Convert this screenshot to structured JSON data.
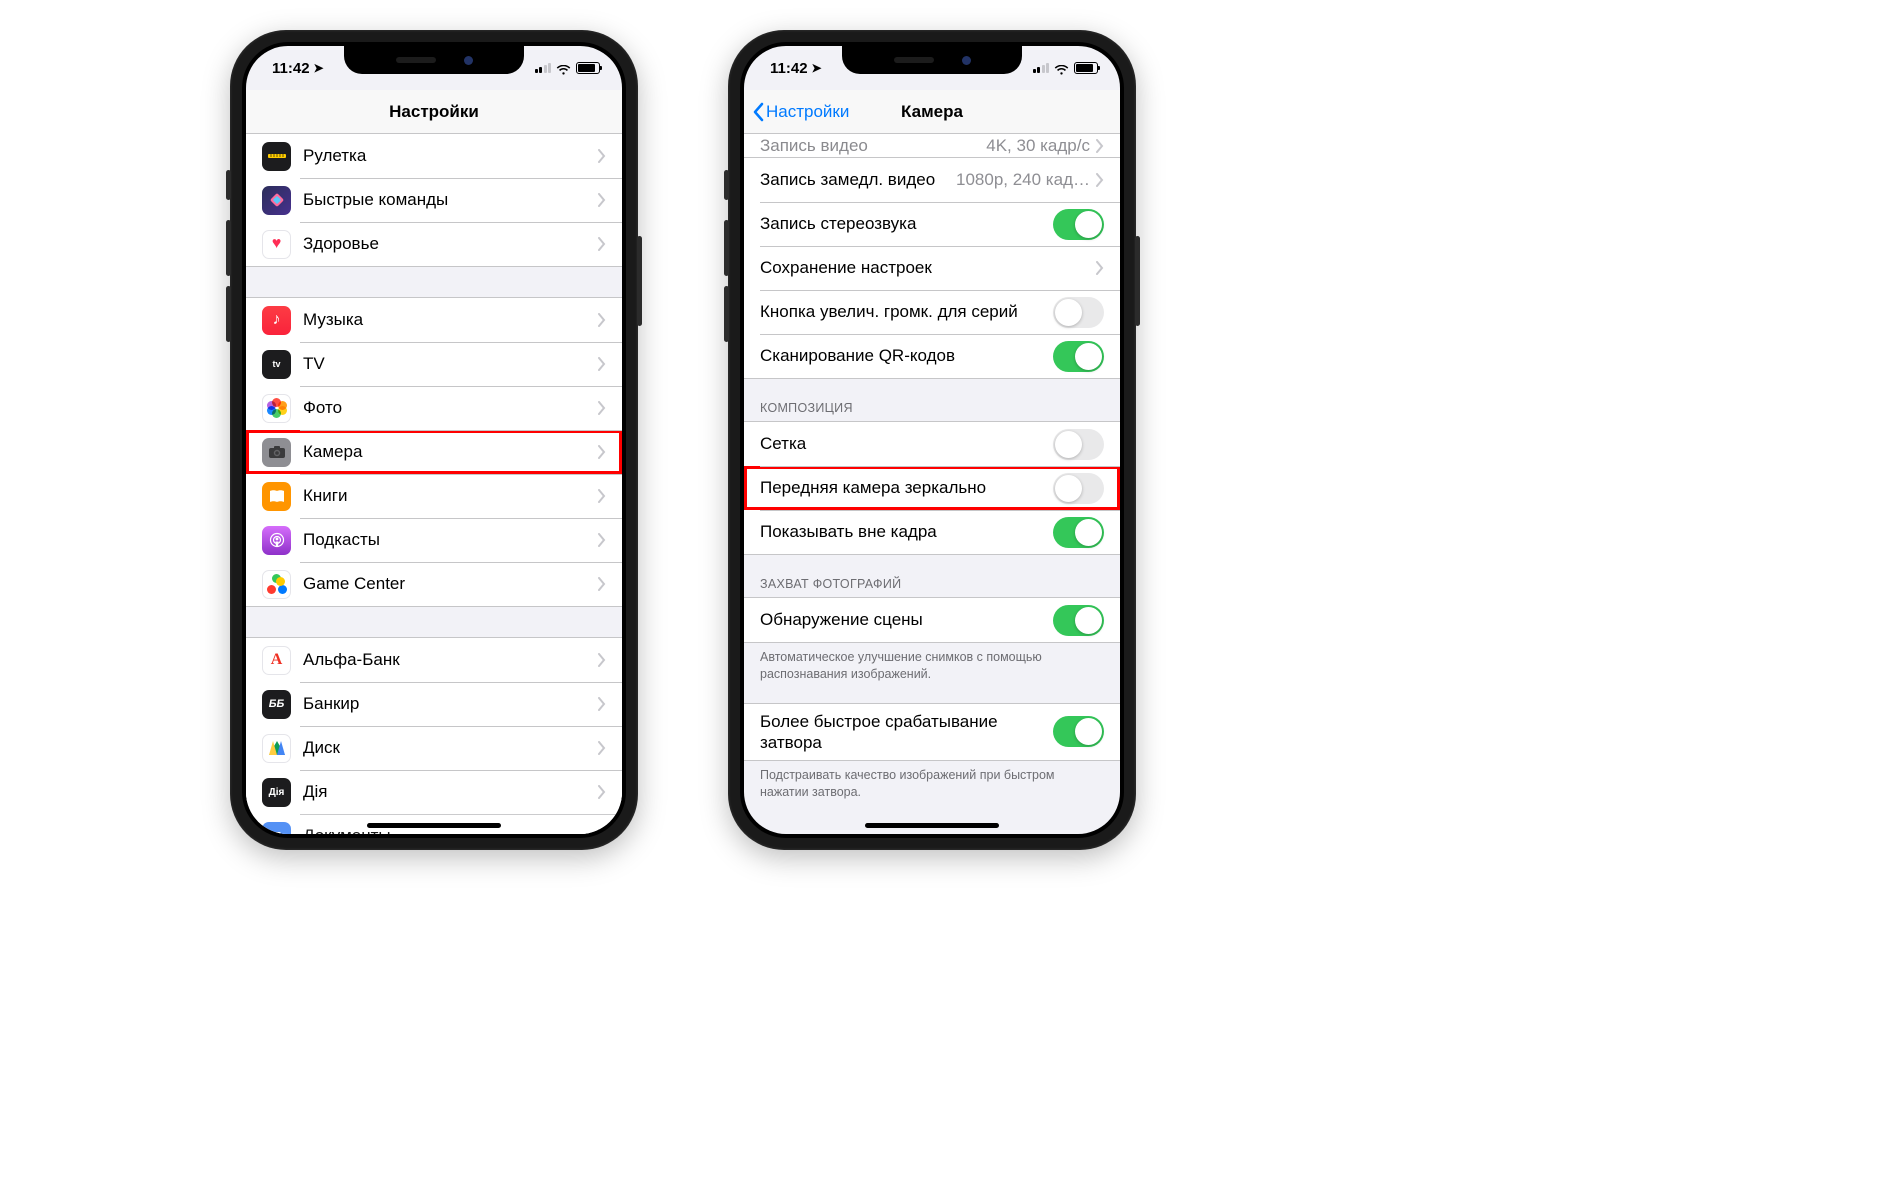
{
  "status": {
    "time": "11:42"
  },
  "left": {
    "nav_title": "Настройки",
    "group1": [
      {
        "label": "Рулетка"
      },
      {
        "label": "Быстрые команды"
      },
      {
        "label": "Здоровье"
      }
    ],
    "group2": [
      {
        "label": "Музыка"
      },
      {
        "label": "TV"
      },
      {
        "label": "Фото"
      },
      {
        "label": "Камера"
      },
      {
        "label": "Книги"
      },
      {
        "label": "Подкасты"
      },
      {
        "label": "Game Center"
      }
    ],
    "group3": [
      {
        "label": "Альфа-Банк"
      },
      {
        "label": "Банкир"
      },
      {
        "label": "Диск"
      },
      {
        "label": "Дія"
      },
      {
        "label": "Документы"
      }
    ]
  },
  "right": {
    "back_label": "Настройки",
    "nav_title": "Камера",
    "partial": {
      "label": "Запись видео",
      "detail": "4K, 30 кадр/с"
    },
    "group1": [
      {
        "label": "Запись замедл. видео",
        "detail": "1080p, 240 кад…",
        "type": "nav"
      },
      {
        "label": "Запись стереозвука",
        "type": "toggle",
        "on": true
      },
      {
        "label": "Сохранение настроек",
        "type": "nav"
      },
      {
        "label": "Кнопка увелич. громк. для серий",
        "type": "toggle",
        "on": false
      },
      {
        "label": "Сканирование QR-кодов",
        "type": "toggle",
        "on": true
      }
    ],
    "header2": "Композиция",
    "group2": [
      {
        "label": "Сетка",
        "type": "toggle",
        "on": false
      },
      {
        "label": "Передняя камера зеркально",
        "type": "toggle",
        "on": false
      },
      {
        "label": "Показывать вне кадра",
        "type": "toggle",
        "on": true
      }
    ],
    "header3": "Захват фотографий",
    "group3": [
      {
        "label": "Обнаружение сцены",
        "type": "toggle",
        "on": true
      }
    ],
    "footer3": "Автоматическое улучшение снимков с помощью распознавания изображений.",
    "group4": [
      {
        "label": "Более быстрое срабатывание затвора",
        "type": "toggle",
        "on": true
      }
    ],
    "footer4": "Подстраивать качество изображений при быстром нажатии затвора."
  }
}
